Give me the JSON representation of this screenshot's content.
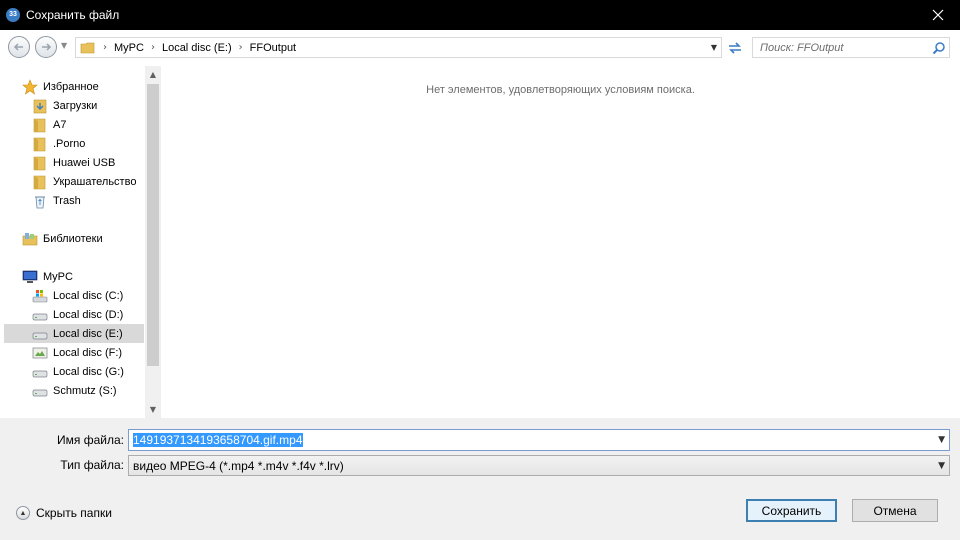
{
  "window": {
    "title": "Сохранить файл"
  },
  "address": {
    "crumbs": [
      "MyPC",
      "Local disc (E:)",
      "FFOutput"
    ]
  },
  "search": {
    "placeholder": "Поиск: FFOutput"
  },
  "nav": {
    "favorites": {
      "label": "Избранное",
      "items": [
        "Загрузки",
        "A7",
        ".Porno",
        "Huawei USB",
        "Украшательство",
        "Trash"
      ]
    },
    "libraries": {
      "label": "Библиотеки"
    },
    "computer": {
      "label": "MyPC",
      "drives": [
        "Local disc (C:)",
        "Local disc (D:)",
        "Local disc (E:)",
        "Local disc (F:)",
        "Local disc (G:)",
        "Schmutz (S:)"
      ],
      "selected": "Local disc (E:)"
    }
  },
  "content": {
    "empty_message": "Нет элементов, удовлетворяющих условиям поиска."
  },
  "form": {
    "filename_label": "Имя файла:",
    "filename_value": "1491937134193658704.gif.mp4",
    "filetype_label": "Тип файла:",
    "filetype_value": "видео MPEG-4 (*.mp4 *.m4v *.f4v *.lrv)"
  },
  "footer": {
    "hide_folders": "Скрыть папки",
    "save": "Сохранить",
    "cancel": "Отмена"
  },
  "colors": {
    "accent": "#3399ff",
    "folder": "#e8c15a",
    "titlebar": "#000000"
  }
}
